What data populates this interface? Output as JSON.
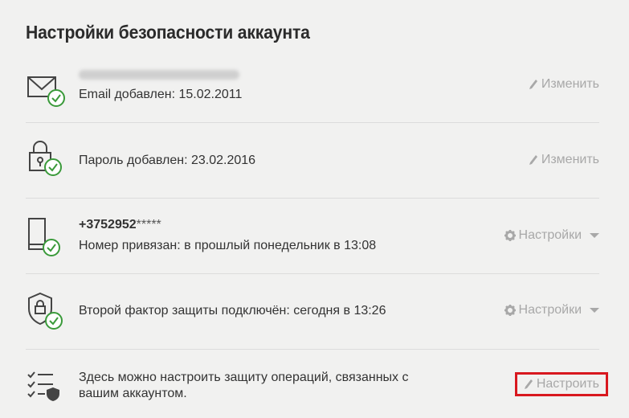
{
  "page": {
    "title": "Настройки безопасности аккаунта"
  },
  "rows": [
    {
      "icon": "envelope-check-icon",
      "primary": "",
      "secondary": "Email добавлен: 15.02.2011",
      "action": {
        "icon": "pencil-icon",
        "label": "Изменить"
      }
    },
    {
      "icon": "lock-check-icon",
      "secondary": "Пароль добавлен: 23.02.2016",
      "action": {
        "icon": "pencil-icon",
        "label": "Изменить"
      }
    },
    {
      "icon": "phone-check-icon",
      "phone_prefix": "+3752952",
      "phone_mask": "*****",
      "secondary": "Номер привязан: в прошлый понедельник в 13:08",
      "action": {
        "icon": "gear-icon",
        "label": "Настройки"
      }
    },
    {
      "icon": "shield-lock-check-icon",
      "secondary": "Второй фактор защиты подключён: сегодня в 13:26",
      "action": {
        "icon": "gear-icon",
        "label": "Настройки"
      }
    },
    {
      "icon": "checklist-shield-icon",
      "secondary_line1": "Здесь можно настроить защиту операций, связанных с",
      "secondary_line2": "вашим аккаунтом.",
      "action": {
        "icon": "pencil-icon",
        "label": "Настроить"
      }
    }
  ],
  "colors": {
    "accent_green": "#3a9a3a",
    "highlight_red": "#d8181f",
    "muted": "#a8a8a8"
  }
}
